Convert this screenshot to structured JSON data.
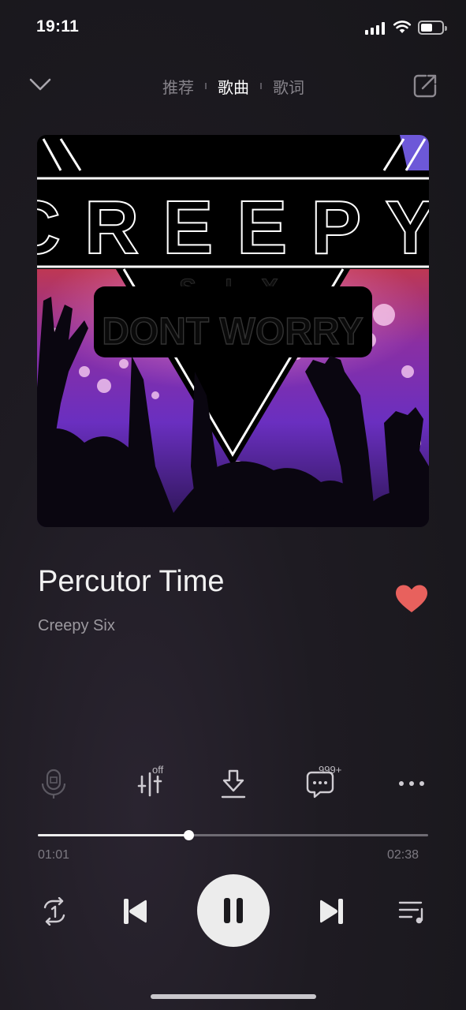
{
  "status_bar": {
    "time": "19:11"
  },
  "nav": {
    "tabs": [
      {
        "label": "推荐",
        "active": false
      },
      {
        "label": "歌曲",
        "active": true
      },
      {
        "label": "歌词",
        "active": false
      }
    ]
  },
  "artwork": {
    "brand": "CREEPY",
    "sub": "S I X",
    "tagline": "DONT WORRY"
  },
  "track": {
    "title": "Percutor Time",
    "artist": "Creepy Six",
    "liked": true
  },
  "toolbar": {
    "effects_badge": "off",
    "comments_badge": "999+"
  },
  "progress": {
    "current": "01:01",
    "total": "02:38",
    "fraction": 0.386
  },
  "colors": {
    "heart": "#e8615d",
    "background": "#1e1b22",
    "accent": "#ececec"
  }
}
